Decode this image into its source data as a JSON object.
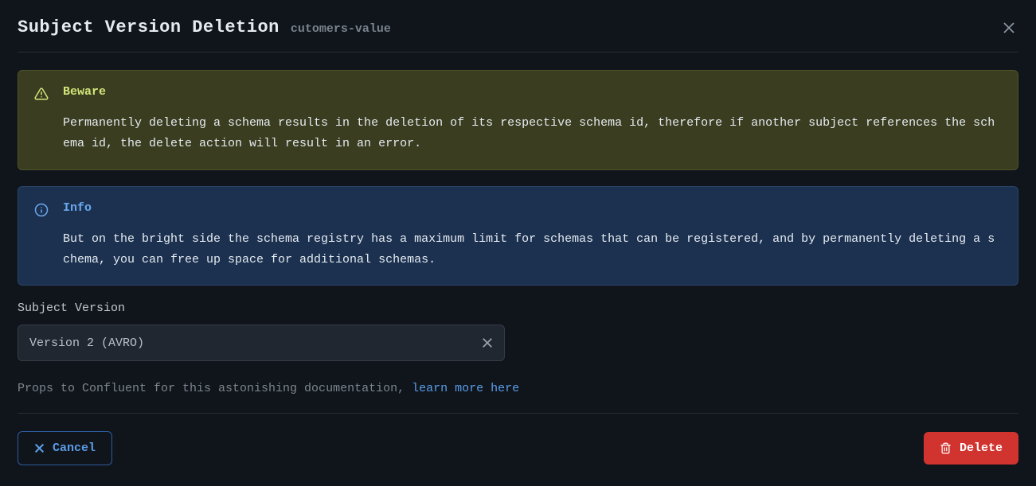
{
  "header": {
    "title": "Subject Version Deletion",
    "subtitle": "cutomers-value"
  },
  "alerts": {
    "beware": {
      "title": "Beware",
      "text": "Permanently deleting a schema results in the deletion of its respective schema id, therefore if another subject references the schema id, the delete action will result in an error."
    },
    "info": {
      "title": "Info",
      "text": "But on the bright side the schema registry has a maximum limit for schemas that can be registered, and by permanently deleting a schema, you can free up space for additional schemas."
    }
  },
  "form": {
    "version_label": "Subject Version",
    "version_value": "Version 2 (AVRO)"
  },
  "footnote": {
    "text": "Props to Confluent for this astonishing documentation, ",
    "link": "learn more here"
  },
  "buttons": {
    "cancel": "Cancel",
    "delete": "Delete"
  }
}
